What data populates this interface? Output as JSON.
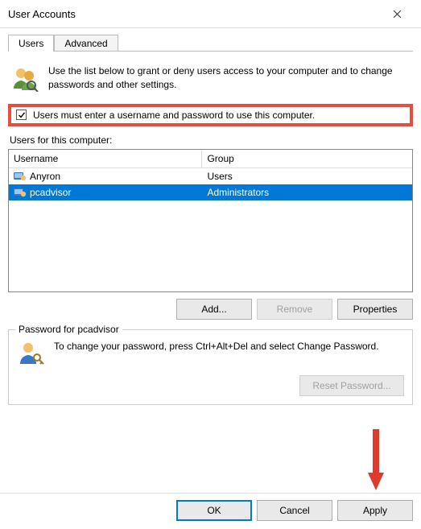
{
  "title": "User Accounts",
  "tabs": [
    {
      "label": "Users",
      "active": true
    },
    {
      "label": "Advanced",
      "active": false
    }
  ],
  "intro": "Use the list below to grant or deny users access to your computer and to change passwords and other settings.",
  "checkbox": {
    "label": "Users must enter a username and password to use this computer.",
    "checked": true
  },
  "list_label": "Users for this computer:",
  "columns": {
    "name": "Username",
    "group": "Group"
  },
  "users": [
    {
      "name": "Anyron",
      "group": "Users",
      "selected": false
    },
    {
      "name": "pcadvisor",
      "group": "Administrators",
      "selected": true
    }
  ],
  "buttons": {
    "add": "Add...",
    "remove": "Remove",
    "properties": "Properties",
    "reset_pw": "Reset Password...",
    "ok": "OK",
    "cancel": "Cancel",
    "apply": "Apply"
  },
  "password": {
    "group_title": "Password for pcadvisor",
    "text": "To change your password, press Ctrl+Alt+Del and select Change Password."
  }
}
